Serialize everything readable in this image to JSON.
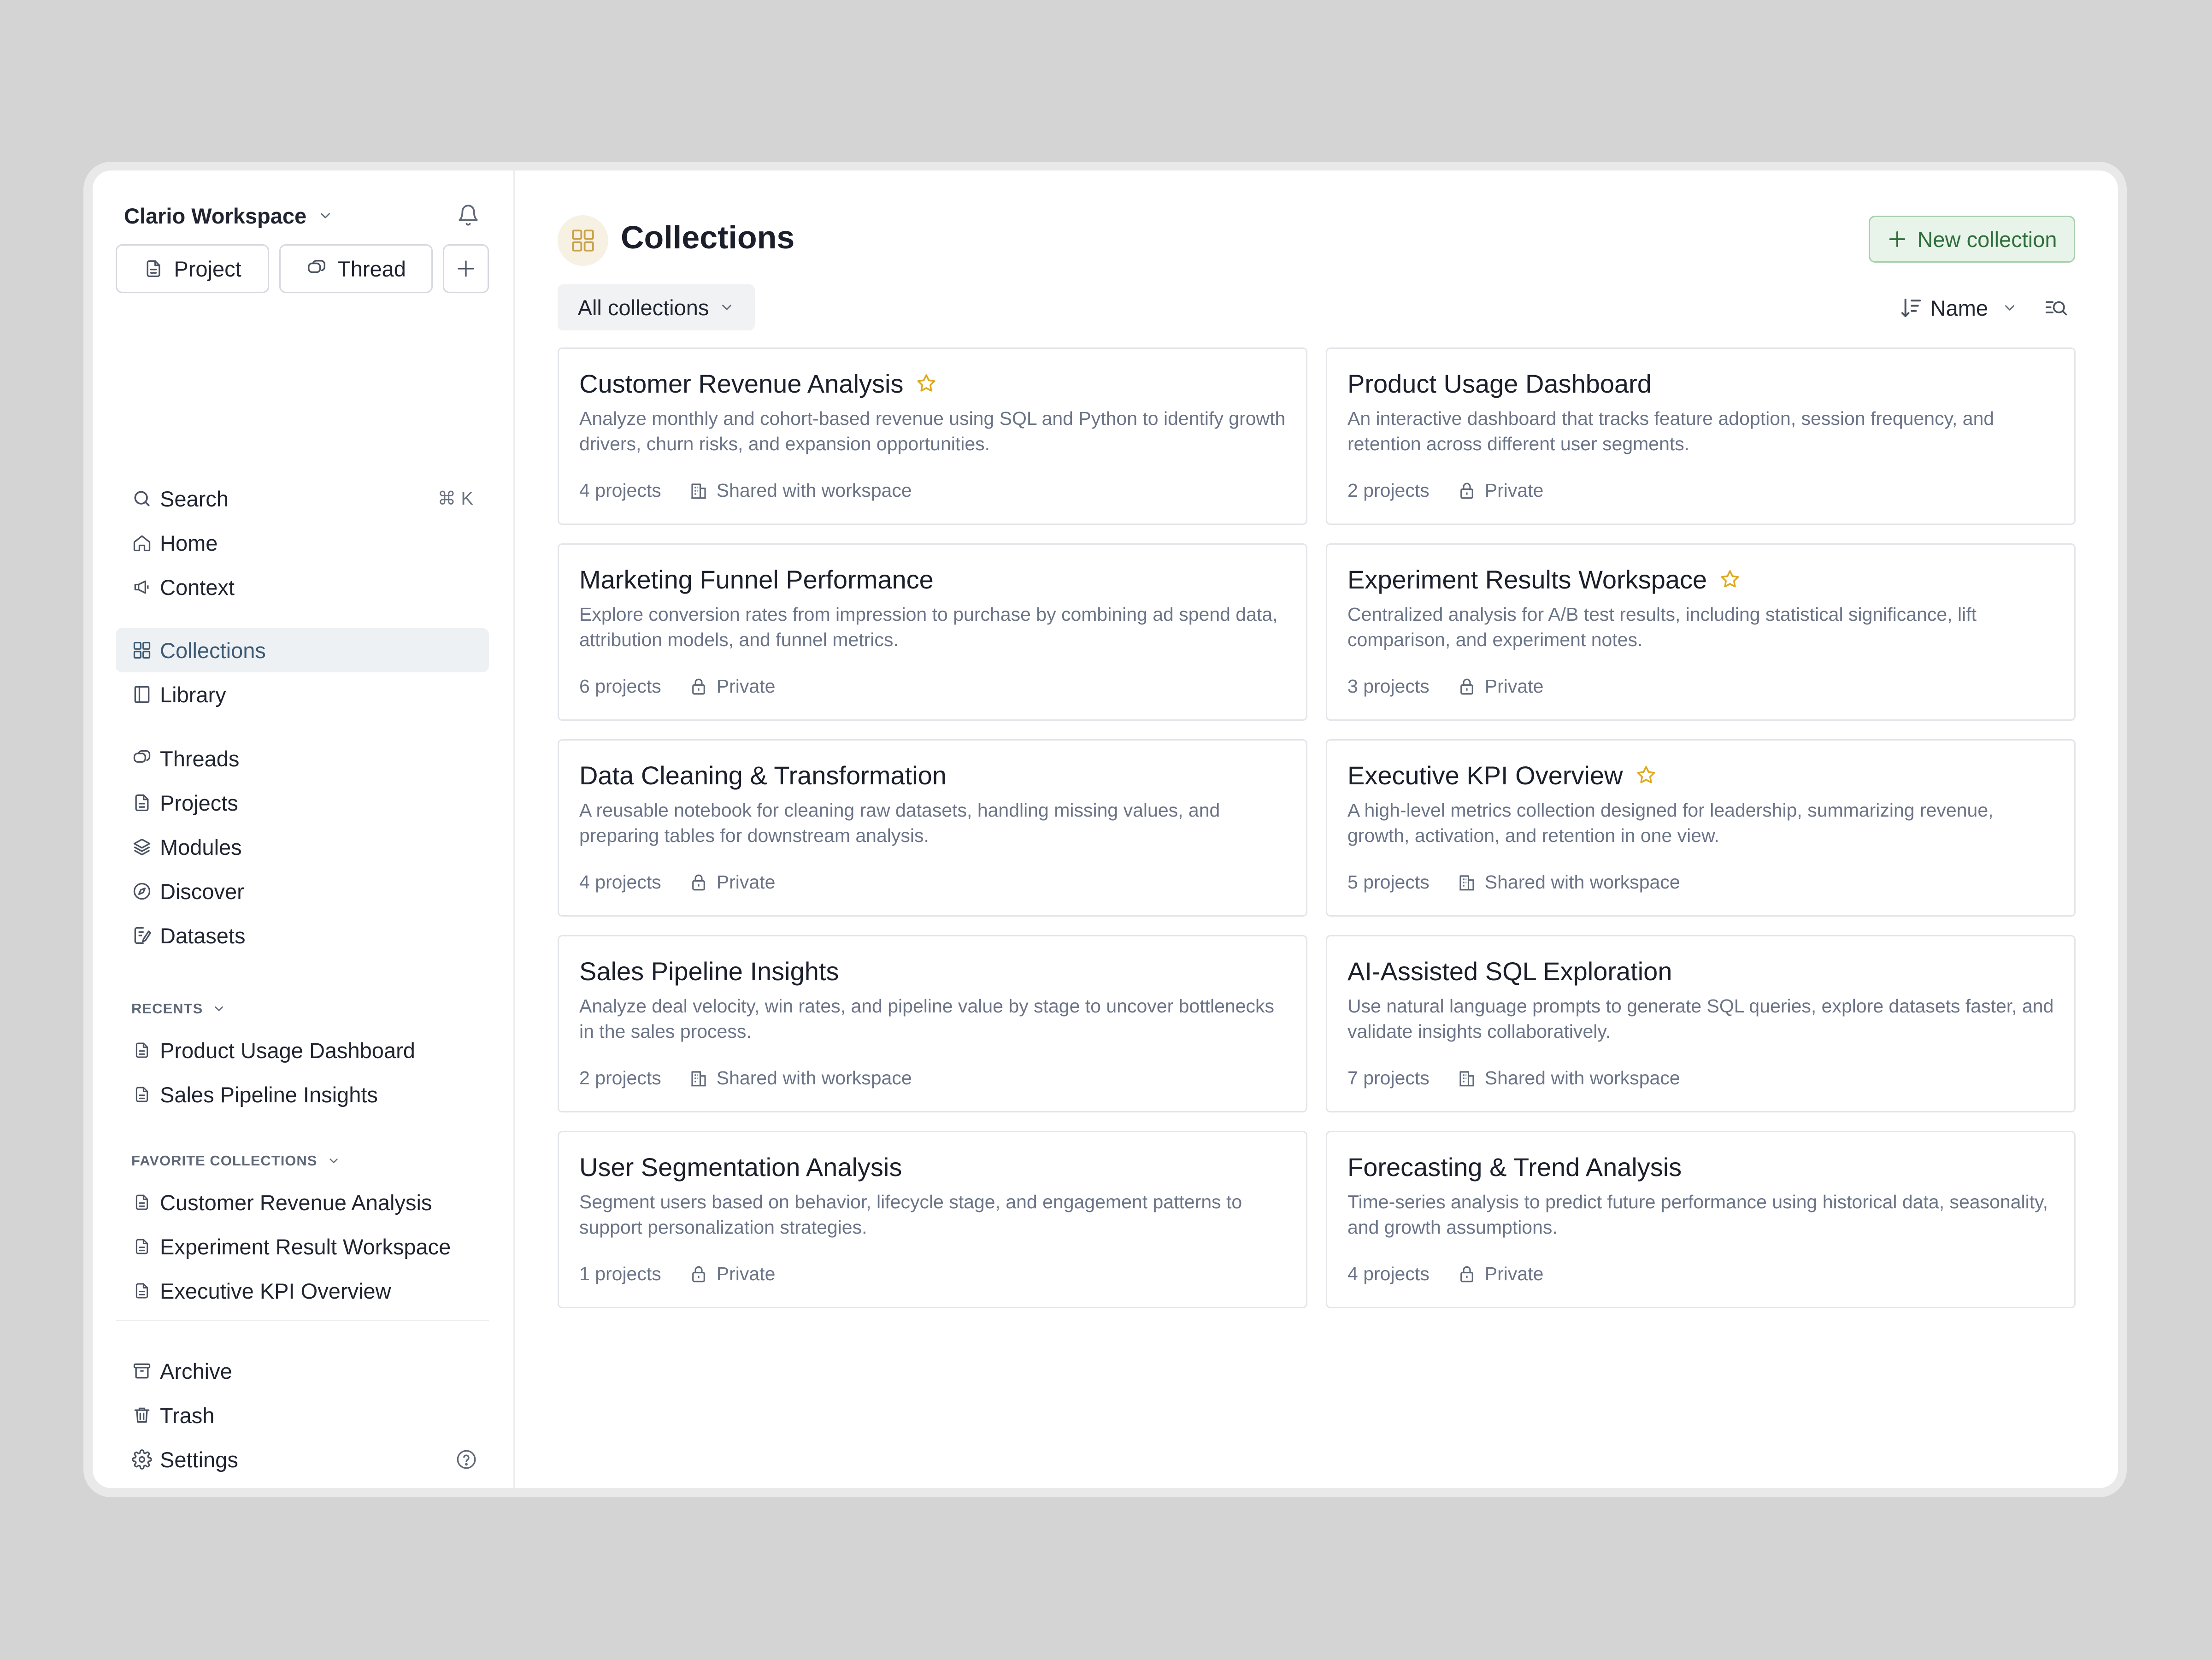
{
  "workspace": {
    "name": "Clario Workspace"
  },
  "quick_actions": {
    "project": "Project",
    "thread": "Thread"
  },
  "nav": {
    "search": "Search",
    "search_shortcut": "⌘ K",
    "home": "Home",
    "context": "Context",
    "collections": "Collections",
    "library": "Library",
    "threads": "Threads",
    "projects": "Projects",
    "modules": "Modules",
    "discover": "Discover",
    "datasets": "Datasets"
  },
  "recents": {
    "label": "RECENTS",
    "items": [
      "Product Usage Dashboard",
      "Sales Pipeline Insights"
    ]
  },
  "favorites": {
    "label": "FAVORITE COLLECTIONS",
    "items": [
      "Customer Revenue Analysis",
      "Experiment Result Workspace",
      "Executive KPI Overview"
    ]
  },
  "footer_nav": {
    "archive": "Archive",
    "trash": "Trash",
    "settings": "Settings"
  },
  "header": {
    "title": "Collections",
    "new_button": "New collection",
    "filter": "All collections",
    "sort": "Name"
  },
  "colors": {
    "accent_green": "#2f6e3b",
    "star": "#e0a91b",
    "active_nav_bg": "#eef1f4"
  },
  "cards": [
    {
      "title": "Customer Revenue Analysis",
      "starred": true,
      "desc": "Analyze monthly and cohort-based revenue using SQL and Python to identify growth drivers, churn risks, and expansion opportunities.",
      "projects": "4 projects",
      "visibility": "Shared with workspace",
      "vis_icon": "building-icon"
    },
    {
      "title": "Product Usage Dashboard",
      "starred": false,
      "desc": "An interactive dashboard that tracks feature adoption, session frequency, and retention across different user segments.",
      "projects": "2 projects",
      "visibility": "Private",
      "vis_icon": "lock-icon"
    },
    {
      "title": "Marketing Funnel Performance",
      "starred": false,
      "desc": "Explore conversion rates from impression to purchase by combining ad spend data, attribution models, and funnel metrics.",
      "projects": "6 projects",
      "visibility": "Private",
      "vis_icon": "lock-icon"
    },
    {
      "title": "Experiment Results Workspace",
      "starred": true,
      "desc": "Centralized analysis for A/B test results, including statistical significance, lift comparison, and experiment notes.",
      "projects": "3 projects",
      "visibility": "Private",
      "vis_icon": "lock-icon"
    },
    {
      "title": "Data Cleaning & Transformation",
      "starred": false,
      "desc": "A reusable notebook for cleaning raw datasets, handling missing values, and preparing tables for downstream analysis.",
      "projects": "4 projects",
      "visibility": "Private",
      "vis_icon": "lock-icon"
    },
    {
      "title": "Executive KPI Overview",
      "starred": true,
      "desc": "A high-level metrics collection designed for leadership, summarizing revenue, growth, activation, and retention in one view.",
      "projects": "5 projects",
      "visibility": "Shared with workspace",
      "vis_icon": "building-icon"
    },
    {
      "title": "Sales Pipeline Insights",
      "starred": false,
      "desc": "Analyze deal velocity, win rates, and pipeline value by stage to uncover bottlenecks in the sales process.",
      "projects": "2 projects",
      "visibility": "Shared with workspace",
      "vis_icon": "building-icon"
    },
    {
      "title": "AI-Assisted SQL Exploration",
      "starred": false,
      "desc": "Use natural language prompts to generate SQL queries, explore datasets faster, and validate insights collaboratively.",
      "projects": "7 projects",
      "visibility": "Shared with workspace",
      "vis_icon": "building-icon"
    },
    {
      "title": "User Segmentation Analysis",
      "starred": false,
      "desc": "Segment users based on behavior, lifecycle stage, and engagement patterns to support personalization strategies.",
      "projects": "1 projects",
      "visibility": "Private",
      "vis_icon": "lock-icon"
    },
    {
      "title": "Forecasting & Trend Analysis",
      "starred": false,
      "desc": "Time-series analysis to predict future performance using historical data, seasonality, and growth assumptions.",
      "projects": "4 projects",
      "visibility": "Private",
      "vis_icon": "lock-icon"
    }
  ]
}
